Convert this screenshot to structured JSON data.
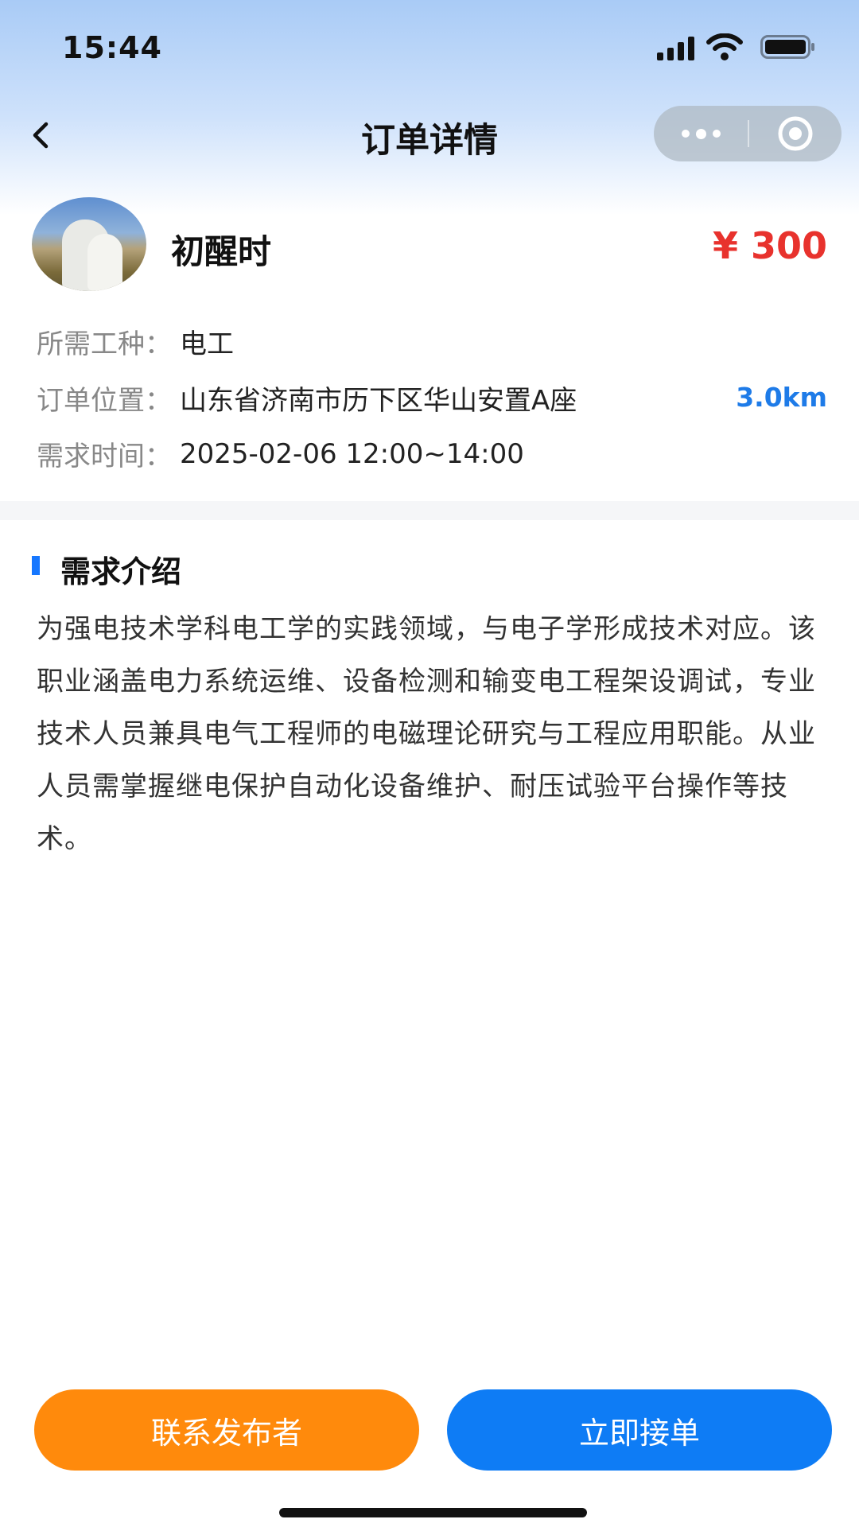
{
  "status_bar": {
    "time": "15:44"
  },
  "nav": {
    "title": "订单详情",
    "back_icon": "chevron-left-icon",
    "more_icon": "more-dots-icon",
    "close_icon": "target-circle-icon"
  },
  "order": {
    "publisher_name": "初醒时",
    "price": "¥ 300",
    "fields": {
      "type_label": "所需工种：",
      "type_value": "电工",
      "location_label": "订单位置：",
      "location_value": "山东省济南市历下区华山安置A座",
      "distance": "3.0km",
      "time_label": "需求时间：",
      "time_value": "2025-02-06 12:00~14:00"
    }
  },
  "intro": {
    "title": "需求介绍",
    "text": "为强电技术学科电工学的实践领域，与电子学形成技术对应。该职业涵盖电力系统运维、设备检测和输变电工程架设调试，专业技术人员兼具电气工程师的电磁理论研究与工程应用职能。从业人员需掌握继电保护自动化设备维护、耐压试验平台操作等技术。"
  },
  "actions": {
    "contact_label": "联系发布者",
    "accept_label": "立即接单"
  },
  "colors": {
    "price": "#e8322d",
    "distance": "#1e7be8",
    "contact_button": "#ff8a0c",
    "accept_button": "#0e7cf5",
    "section_accent": "#1677ff"
  }
}
